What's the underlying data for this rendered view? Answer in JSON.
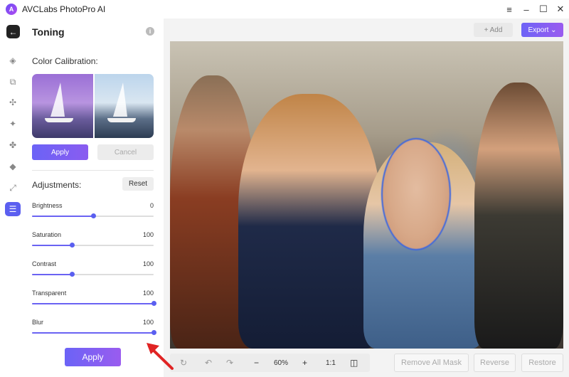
{
  "app": {
    "title": "AVCLabs PhotoPro AI"
  },
  "window_controls": [
    "menu-icon",
    "minimize-icon",
    "maximize-icon",
    "close-icon"
  ],
  "rail": {
    "icons": [
      "eraser-icon",
      "replace-icon",
      "enhance-icon",
      "sparkle-icon",
      "puzzle-icon",
      "fill-icon",
      "resize-icon",
      "toning-icon"
    ],
    "active": "toning-icon"
  },
  "panel": {
    "title": "Toning",
    "color_calibration": {
      "label": "Color Calibration:",
      "apply_label": "Apply",
      "cancel_label": "Cancel"
    },
    "adjustments": {
      "label": "Adjustments:",
      "reset_label": "Reset",
      "sliders": [
        {
          "label": "Brightness",
          "value": "0",
          "fill": 0.5
        },
        {
          "label": "Saturation",
          "value": "100",
          "fill": 0.33
        },
        {
          "label": "Contrast",
          "value": "100",
          "fill": 0.33
        },
        {
          "label": "Transparent",
          "value": "100",
          "fill": 1.0
        },
        {
          "label": "Blur",
          "value": "100",
          "fill": 1.0
        }
      ]
    },
    "apply_label": "Apply"
  },
  "toolbar": {
    "add_label": "+ Add",
    "export_label": "Export"
  },
  "bottom_bar": {
    "zoom": "60%",
    "ratio": "1:1",
    "remove_all_mask": "Remove All Mask",
    "reverse": "Reverse",
    "restore": "Restore"
  },
  "colors": {
    "accent": "#5b5ff0",
    "mask_outline": "#3b66e0",
    "arrow": "#e02424"
  }
}
